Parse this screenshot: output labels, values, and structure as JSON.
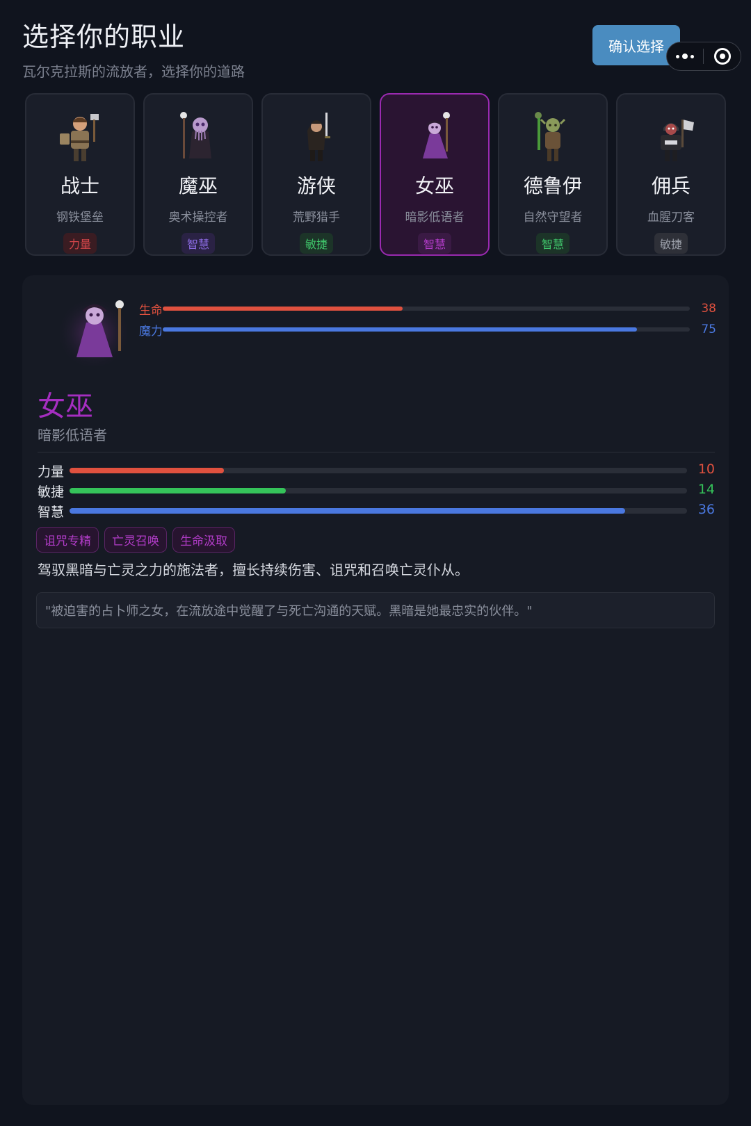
{
  "header": {
    "title": "选择你的职业",
    "subtitle": "瓦尔克拉斯的流放者，选择你的道路",
    "confirm_label": "确认选择"
  },
  "colors": {
    "selected_border": "#9a2ab0",
    "confirm_button": "#4a8cc0",
    "hp": "#e0513f",
    "mp": "#4a78e0",
    "str": "#e0513f",
    "agi": "#35c35a",
    "int": "#4a78e0"
  },
  "classes": [
    {
      "name": "战士",
      "subtitle": "钢铁堡垒",
      "attribute": "力量",
      "icon": "warrior-icon",
      "selected": false
    },
    {
      "name": "魔巫",
      "subtitle": "奥术操控者",
      "attribute": "智慧",
      "icon": "mind-flayer-icon",
      "selected": false
    },
    {
      "name": "游侠",
      "subtitle": "荒野猎手",
      "attribute": "敏捷",
      "icon": "ranger-icon",
      "selected": false
    },
    {
      "name": "女巫",
      "subtitle": "暗影低语者",
      "attribute": "智慧",
      "icon": "witch-icon",
      "selected": true
    },
    {
      "name": "德鲁伊",
      "subtitle": "自然守望者",
      "attribute": "智慧",
      "icon": "druid-icon",
      "selected": false
    },
    {
      "name": "佣兵",
      "subtitle": "血腥刀客",
      "attribute": "敏捷",
      "icon": "mercenary-icon",
      "selected": false
    }
  ],
  "detail": {
    "avatar_icon": "witch-icon",
    "vitals": {
      "hp_label": "生命",
      "hp_value": 38,
      "hp_fraction": 0.455,
      "mp_label": "魔力",
      "mp_value": 75,
      "mp_fraction": 0.9
    },
    "name": "女巫",
    "subtitle": "暗影低语者",
    "attributes": [
      {
        "label": "力量",
        "value": 10,
        "fraction": 0.25
      },
      {
        "label": "敏捷",
        "value": 14,
        "fraction": 0.35
      },
      {
        "label": "智慧",
        "value": 36,
        "fraction": 0.9
      }
    ],
    "tags": [
      "诅咒专精",
      "亡灵召唤",
      "生命汲取"
    ],
    "description": "驾驭黑暗与亡灵之力的施法者，擅长持续伤害、诅咒和召唤亡灵仆从。",
    "quote": "\"被迫害的占卜师之女，在流放途中觉醒了与死亡沟通的天赋。黑暗是她最忠实的伙伴。\""
  }
}
